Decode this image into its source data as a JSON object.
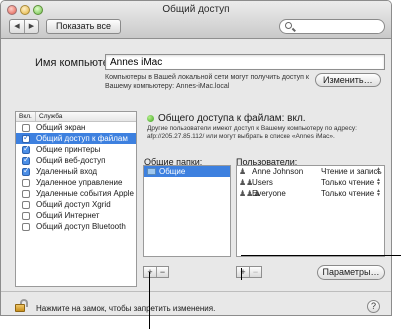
{
  "window": {
    "title": "Общий доступ"
  },
  "toolbar": {
    "back_glyph": "◀",
    "forward_glyph": "▶",
    "show_all_label": "Показать все",
    "search_placeholder": ""
  },
  "computer": {
    "label": "Имя компьютера:",
    "name_value": "Annes iMac",
    "hint": "Компьютеры в Вашей локальной сети могут получить доступ к Вашему компьютеру: Annes-iMac.local",
    "edit_label": "Изменить…"
  },
  "services": {
    "header_on": "Вкл.",
    "header_service": "Служба",
    "items": [
      {
        "label": "Общий экран",
        "checked": false,
        "selected": false
      },
      {
        "label": "Общий доступ к файлам",
        "checked": true,
        "selected": true
      },
      {
        "label": "Общие принтеры",
        "checked": true,
        "selected": false
      },
      {
        "label": "Общий веб-доступ",
        "checked": true,
        "selected": false
      },
      {
        "label": "Удаленный вход",
        "checked": true,
        "selected": false
      },
      {
        "label": "Удаленное управление",
        "checked": false,
        "selected": false
      },
      {
        "label": "Удаленные события Apple",
        "checked": false,
        "selected": false
      },
      {
        "label": "Общий доступ Xgrid",
        "checked": false,
        "selected": false
      },
      {
        "label": "Общий Интернет",
        "checked": false,
        "selected": false
      },
      {
        "label": "Общий доступ Bluetooth",
        "checked": false,
        "selected": false
      }
    ]
  },
  "status": {
    "text": "Общего доступа к файлам: вкл.",
    "description": "Другие пользователи имеют доступ к Вашему компьютеру по адресу: afp://205.27.85.112/ или могут выбрать в списке «Annes iMac».",
    "indicator_color": "#3aa21e"
  },
  "folders": {
    "label": "Общие папки:",
    "items": [
      {
        "name": "Общие",
        "icon": "folder-icon"
      }
    ]
  },
  "users": {
    "label": "Пользователи:",
    "items": [
      {
        "name": "Anne Johnson",
        "icon": "single-user-icon",
        "glyph": "♟",
        "permission": "Чтение и запись"
      },
      {
        "name": "Users",
        "icon": "group-icon",
        "glyph": "♟♟",
        "permission": "Только чтение"
      },
      {
        "name": "Everyone",
        "icon": "everyone-icon",
        "glyph": "♟♟♟",
        "permission": "Только чтение"
      }
    ]
  },
  "buttons": {
    "plus": "+",
    "minus": "−",
    "options": "Параметры…",
    "help": "?"
  },
  "lock_text": "Нажмите на замок, чтобы запретить изменения.",
  "colors": {
    "selection": "#3d80df",
    "window_bg": "#e8e8e8"
  }
}
